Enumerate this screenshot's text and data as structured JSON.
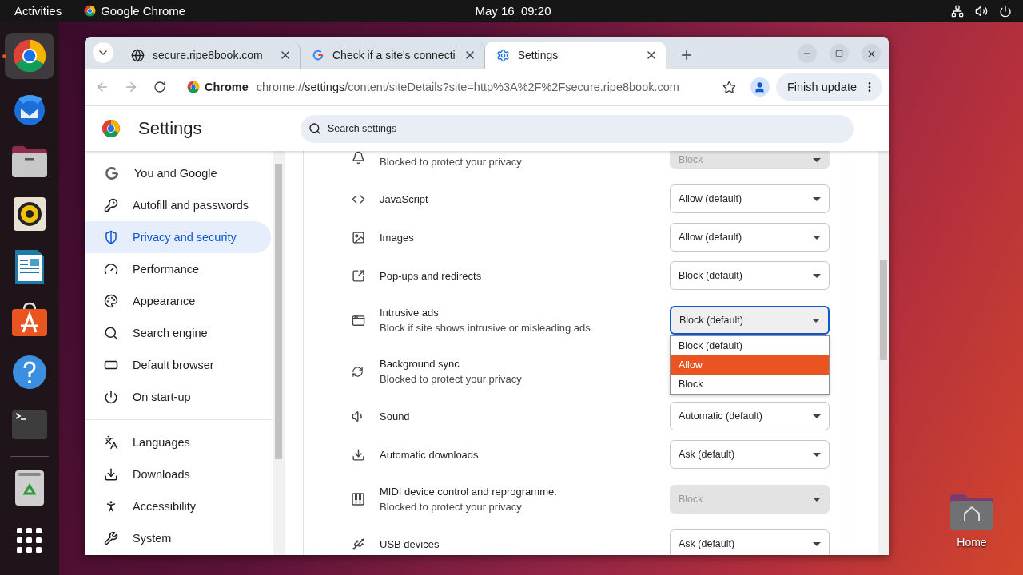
{
  "top_bar": {
    "activities": "Activities",
    "app_name": "Google Chrome",
    "clock": "May 16  09:20"
  },
  "dock": [
    {
      "kind": "chrome",
      "active": true
    },
    {
      "kind": "thunderbird",
      "active": false
    },
    {
      "kind": "files",
      "active": false
    },
    {
      "kind": "rhythmbox",
      "active": false
    },
    {
      "kind": "writer",
      "active": false
    },
    {
      "kind": "appcenter",
      "active": false
    },
    {
      "kind": "help",
      "active": false
    },
    {
      "kind": "terminal",
      "active": false
    },
    {
      "kind": "trash",
      "active": false
    },
    {
      "kind": "apps",
      "active": false
    }
  ],
  "desktop_icons": [
    {
      "label": "Home"
    }
  ],
  "browser": {
    "tabs": [
      {
        "kind": "globe",
        "title": "secure.ripe8book.com",
        "selected": false
      },
      {
        "kind": "google",
        "title": "Check if a site's connecti",
        "selected": false
      },
      {
        "kind": "gear",
        "title": "Settings",
        "selected": true
      }
    ],
    "address_bar": {
      "chip": "Chrome",
      "url": "chrome://**settings**/content/siteDetails?site=http%3A%2F%2Fsecure.ripe8book.com"
    },
    "update_button": "Finish update"
  },
  "settings": {
    "title": "Settings",
    "search": {
      "placeholder": "Search settings"
    },
    "sidebar": [
      [
        {
          "kind": "google",
          "label": "You and Google",
          "selected": false
        },
        {
          "kind": "key",
          "label": "Autofill and passwords",
          "selected": false
        },
        {
          "kind": "shield",
          "label": "Privacy and security",
          "selected": true
        },
        {
          "kind": "gauge",
          "label": "Performance",
          "selected": false
        },
        {
          "kind": "palette",
          "label": "Appearance",
          "selected": false
        },
        {
          "kind": "search",
          "label": "Search engine",
          "selected": false
        },
        {
          "kind": "browser",
          "label": "Default browser",
          "selected": false
        },
        {
          "kind": "power",
          "label": "On start-up",
          "selected": false
        }
      ],
      [
        {
          "kind": "languages",
          "label": "Languages",
          "selected": false
        },
        {
          "kind": "download",
          "label": "Downloads",
          "selected": false
        },
        {
          "kind": "accessibility",
          "label": "Accessibility",
          "selected": false
        },
        {
          "kind": "wrench",
          "label": "System",
          "selected": false
        }
      ]
    ],
    "rows": [
      {
        "kind": "bell",
        "description": "Blocked to protect your privacy",
        "value": "Block",
        "disabled": true
      },
      {
        "kind": "code",
        "title": "JavaScript",
        "value": "Allow (default)",
        "disabled": false
      },
      {
        "kind": "image",
        "title": "Images",
        "value": "Allow (default)",
        "disabled": false
      },
      {
        "kind": "external",
        "title": "Pop-ups and redirects",
        "value": "Block (default)",
        "disabled": false
      },
      {
        "kind": "window",
        "title": "Intrusive ads",
        "description": "Block if site shows intrusive or misleading ads",
        "value": "Block (default)",
        "disabled": false,
        "open": true,
        "options": [
          {
            "label": "Block (default)",
            "highlighted": false
          },
          {
            "label": "Allow",
            "highlighted": true
          },
          {
            "label": "Block",
            "highlighted": false
          }
        ]
      },
      {
        "kind": "sync",
        "title": "Background sync",
        "description": "Blocked to protect your privacy"
      },
      {
        "kind": "sound",
        "title": "Sound",
        "value": "Automatic (default)",
        "disabled": false
      },
      {
        "kind": "download",
        "title": "Automatic downloads",
        "value": "Ask (default)",
        "disabled": false
      },
      {
        "kind": "piano",
        "title": "MIDI device control and reprogramme.",
        "description": "Blocked to protect your privacy",
        "value": "Block",
        "disabled": true
      },
      {
        "kind": "usb",
        "title": "USB devices",
        "value": "Ask (default)",
        "disabled": false
      }
    ]
  }
}
